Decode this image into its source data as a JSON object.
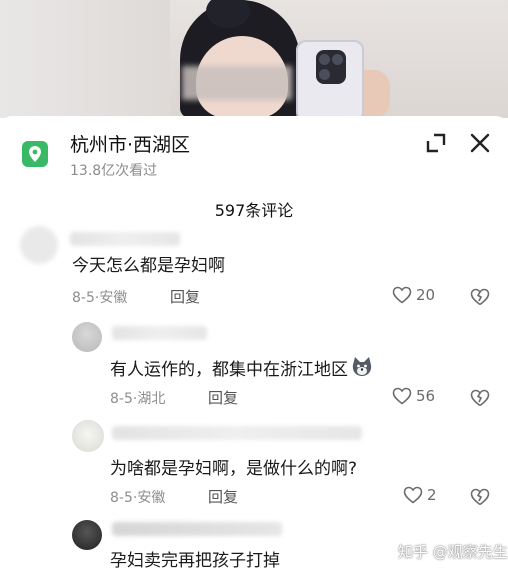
{
  "location": {
    "title": "杭州市·西湖区",
    "views": "13.8亿次看过"
  },
  "comment_count": "597条评论",
  "comments": [
    {
      "text": "今天怎么都是孕妇啊",
      "date": "8-5",
      "place": "安徽",
      "reply": "回复",
      "likes": "20"
    },
    {
      "text": "有人运作的，都集中在浙江地区",
      "date": "8-5",
      "place": "湖北",
      "reply": "回复",
      "likes": "56"
    },
    {
      "text": "为啥都是孕妇啊，是做什么的啊?",
      "date": "8-5",
      "place": "安徽",
      "reply": "回复",
      "likes": "2"
    },
    {
      "text": "孕妇卖完再把孩子打掉"
    }
  ],
  "watermark": "知乎 @观察先生",
  "colors": {
    "location_icon": "#39b966",
    "meta": "#8e8e8e"
  }
}
